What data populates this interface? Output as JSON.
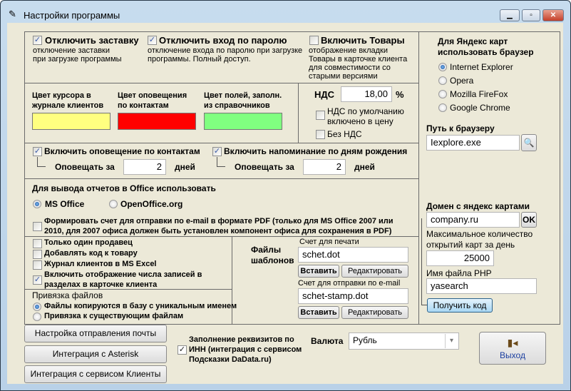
{
  "window": {
    "title": "Настройки программы",
    "minimize": "▁",
    "maximize": "▫",
    "close": "✕"
  },
  "top": {
    "disable_splash": {
      "label": "Отключить заставку",
      "desc1": "отключение заставки",
      "desc2": "при загрузке программы",
      "checked": true
    },
    "disable_password": {
      "label": "Отключить вход по паролю",
      "desc1": "отключение входа по паролю при загрузке",
      "desc2": "программы. Полный доступ.",
      "checked": true
    },
    "enable_goods": {
      "label": "Включить Товары",
      "desc": [
        "отображение вкладки",
        "Товары в карточке клиента",
        "для совместимости со",
        "старыми версиями"
      ],
      "checked": false
    }
  },
  "colors": {
    "cursor": {
      "label1": "Цвет курсора в",
      "label2": "журнале клиентов",
      "color": "#ffff80"
    },
    "notify": {
      "label1": "Цвет оповещения",
      "label2": "по контактам",
      "color": "#ff0000"
    },
    "fields": {
      "label1": "Цвет полей, заполн.",
      "label2": "из справочников",
      "color": "#80ff80"
    }
  },
  "vat": {
    "label": "НДС",
    "value": "18,00",
    "unit": "%",
    "included_l1": "НДС по умолчанию",
    "included_l2": "включено в цену",
    "included": false,
    "no_vat": "Без НДС",
    "no_vat_checked": false
  },
  "notify": {
    "contacts": {
      "label": "Включить оповещение по контактам",
      "checked": true,
      "notify_for": "Оповещать за",
      "days": "2",
      "days_label": "дней"
    },
    "birthdays": {
      "label": "Включить напоминание по дням рождения",
      "checked": true,
      "notify_for": "Оповещать за",
      "days": "2",
      "days_label": "дней"
    }
  },
  "office": {
    "title": "Для вывода отчетов в Office использовать",
    "ms": "MS Office",
    "oo": "OpenOffice.org",
    "selected": "MS Office",
    "pdf_l1": "Формировать счет для отправки по e-mail в формате PDF (только для MS Office 2007 или",
    "pdf_l2": "2010, для 2007 офиса должен быть установлен компонент офиса для  сохранения в PDF)",
    "pdf_checked": false
  },
  "options": [
    {
      "label": "Только один продавец",
      "checked": false
    },
    {
      "label": "Добавлять код к товару",
      "checked": false
    },
    {
      "label": "Журнал клиентов в MS Excel",
      "checked": false
    },
    {
      "label1": "Включить отображение числа записей в",
      "label2": "разделах в карточке клиента",
      "checked": true
    }
  ],
  "files_link": {
    "title": "Привязка файлов",
    "unique": "Файлы копируются в базу с уникальным именем",
    "existing": "Привязка к существующим файлам",
    "selected": "unique"
  },
  "templates": {
    "title1": "Файлы",
    "title2": "шаблонов",
    "print_label": "Счет для печати",
    "print_value": "schet.dot",
    "email_label": "Счет для отправки по e-mail",
    "email_value": "schet-stamp.dot",
    "insert": "Вставить",
    "edit": "Редактировать"
  },
  "browser": {
    "title1": "Для Яндекс карт",
    "title2": "использовать браузер",
    "options": [
      "Internet Explorer",
      "Opera",
      "Mozilla FireFox",
      "Google Chrome"
    ],
    "selected": "Internet Explorer",
    "path_label": "Путь к браузеру",
    "path_value": "Iexplore.exe"
  },
  "yandex": {
    "domain_label": "Домен с яндекс картами",
    "domain_value": "company.ru",
    "ok": "OK",
    "max_l1": "Максимальное количество",
    "max_l2": "открытий карт за день",
    "max_value": "25000",
    "php_label": "Имя файла PHP",
    "php_value": "yasearch",
    "get_code": "Получить код"
  },
  "bottom": {
    "mail_settings": "Настройка отправления почты",
    "asterisk": "Интеграция с Asterisk",
    "clients": "Интеграция с сервисом Клиенты",
    "inn_l1": "Заполнение реквизитов по",
    "inn_l2": "ИНН (интеграция с сервисом",
    "inn_l3": "Подсказки DaData.ru)",
    "inn_checked": true,
    "currency_label": "Валюта",
    "currency_value": "Рубль",
    "exit": "Выход"
  }
}
